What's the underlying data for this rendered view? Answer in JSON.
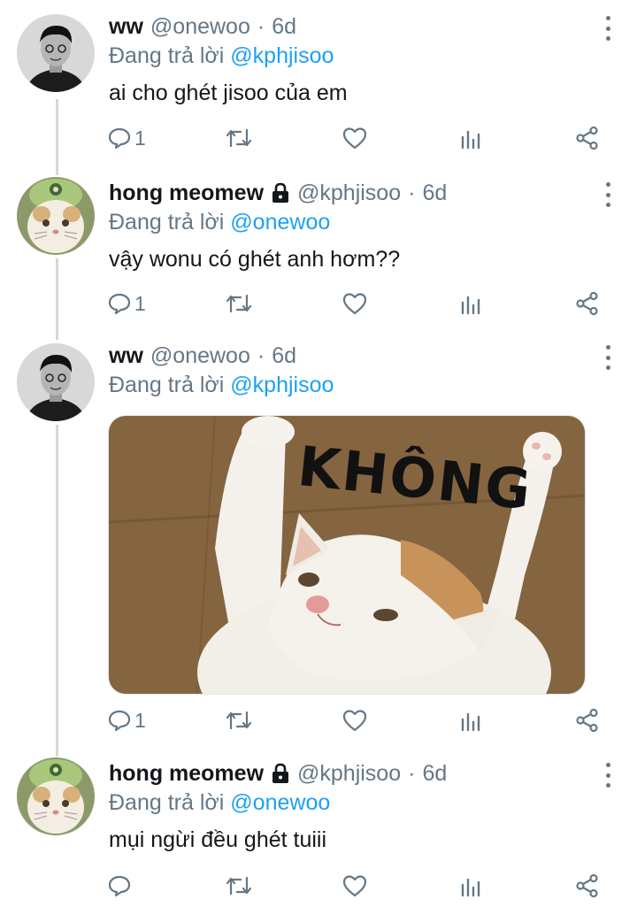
{
  "tweets": [
    {
      "name": "ww",
      "handle": "@onewoo",
      "time": "6d",
      "reply_prefix": "Đang trả lời",
      "reply_to": "@kphjisoo",
      "text": "ai cho ghét jisoo của em",
      "reply_count": "1",
      "locked": false,
      "avatar": "avatar-person"
    },
    {
      "name": "hong meomew",
      "handle": "@kphjisoo",
      "time": "6d",
      "reply_prefix": "Đang trả lời",
      "reply_to": "@onewoo",
      "text": "vậy wonu có ghét anh hơm??",
      "reply_count": "1",
      "locked": true,
      "avatar": "avatar-cat"
    },
    {
      "name": "ww",
      "handle": "@onewoo",
      "time": "6d",
      "reply_prefix": "Đang trả lời",
      "reply_to": "@kphjisoo",
      "media_text": "KHÔNG",
      "reply_count": "1",
      "locked": false,
      "avatar": "avatar-person"
    },
    {
      "name": "hong meomew",
      "handle": "@kphjisoo",
      "time": "6d",
      "reply_prefix": "Đang trả lời",
      "reply_to": "@onewoo",
      "text": "mụi ngừi đều ghét tuiii",
      "reply_count": "",
      "locked": true,
      "avatar": "avatar-cat"
    }
  ],
  "dot_separator": "·",
  "colors": {
    "mention": "#1da1f2",
    "muted": "#657786",
    "text": "#14171a",
    "thread": "#cfd9de"
  },
  "icons": [
    "reply-icon",
    "retweet-icon",
    "like-icon",
    "analytics-icon",
    "share-icon",
    "more-icon",
    "lock-icon"
  ]
}
